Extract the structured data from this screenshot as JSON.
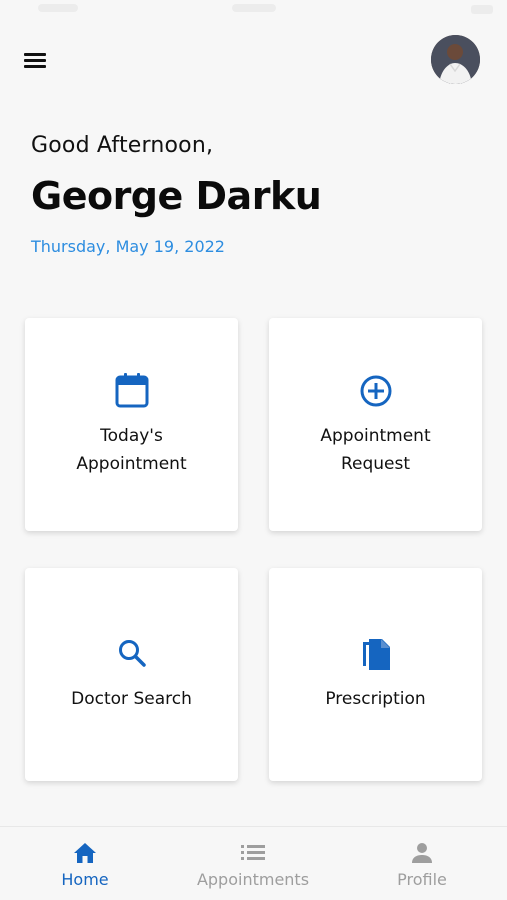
{
  "header": {
    "greeting": "Good Afternoon,",
    "user_name": "George Darku",
    "date": "Thursday, May 19, 2022"
  },
  "cards": [
    {
      "label_line1": "Today's",
      "label_line2": "Appointment",
      "icon": "calendar-icon"
    },
    {
      "label_line1": "Appointment",
      "label_line2": "Request",
      "icon": "plus-circle-icon"
    },
    {
      "label": "Doctor Search",
      "icon": "search-icon"
    },
    {
      "label": "Prescription",
      "icon": "document-icon"
    }
  ],
  "bottom_nav": {
    "items": [
      {
        "label": "Home",
        "icon": "home-icon",
        "active": true
      },
      {
        "label": "Appointments",
        "icon": "list-icon",
        "active": false
      },
      {
        "label": "Profile",
        "icon": "person-icon",
        "active": false
      }
    ]
  },
  "colors": {
    "primary": "#1565c0",
    "date_text": "#2d8de0",
    "inactive_nav": "#9e9e9e",
    "background": "#f7f7f7"
  }
}
